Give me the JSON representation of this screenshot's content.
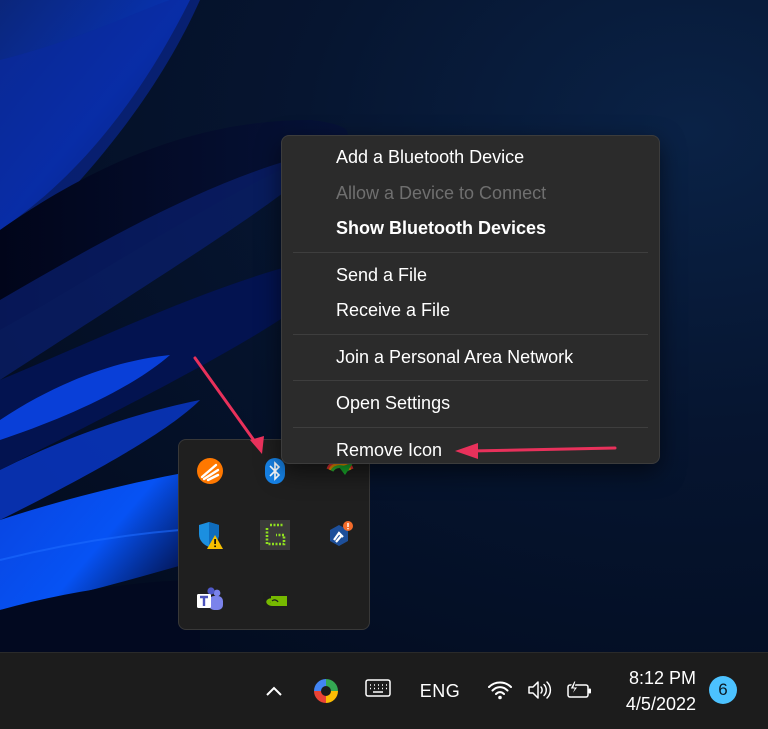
{
  "context_menu": {
    "items": [
      {
        "label": "Add a Bluetooth Device",
        "enabled": true,
        "bold": false
      },
      {
        "label": "Allow a Device to Connect",
        "enabled": false,
        "bold": false
      },
      {
        "label": "Show Bluetooth Devices",
        "enabled": true,
        "bold": true
      },
      {
        "label": "Send a File",
        "enabled": true,
        "bold": false
      },
      {
        "label": "Receive a File",
        "enabled": true,
        "bold": false
      },
      {
        "label": "Join a Personal Area Network",
        "enabled": true,
        "bold": false
      },
      {
        "label": "Open Settings",
        "enabled": true,
        "bold": false
      },
      {
        "label": "Remove Icon",
        "enabled": true,
        "bold": false
      }
    ]
  },
  "tray_overflow": {
    "icons": [
      {
        "name": "avast-icon",
        "label": "Avast Antivirus"
      },
      {
        "name": "bluetooth-icon",
        "label": "Bluetooth"
      },
      {
        "name": "internet-download-manager-icon",
        "label": "Internet Download Manager"
      },
      {
        "name": "windows-security-warning-icon",
        "label": "Windows Security"
      },
      {
        "name": "greenshot-icon",
        "label": "Greenshot"
      },
      {
        "name": "app-update-alert-icon",
        "label": "Updater"
      },
      {
        "name": "microsoft-teams-icon",
        "label": "Microsoft Teams"
      },
      {
        "name": "nvidia-icon",
        "label": "NVIDIA"
      }
    ]
  },
  "taskbar": {
    "show_hidden_icons": "chevron-up-icon",
    "pinned_tray_app": "screen-recorder-icon",
    "touch_keyboard": "keyboard-icon",
    "language": "ENG",
    "wifi": "wifi-icon",
    "volume": "speaker-icon",
    "battery": "battery-charging-icon",
    "time": "8:12 PM",
    "date": "4/5/2022",
    "notification_count": "6"
  },
  "colors": {
    "annotation_arrow": "#e8315b",
    "notification_badge": "#4cc2ff",
    "menu_bg": "#2b2b2b",
    "taskbar_bg": "#1c1c1c"
  }
}
